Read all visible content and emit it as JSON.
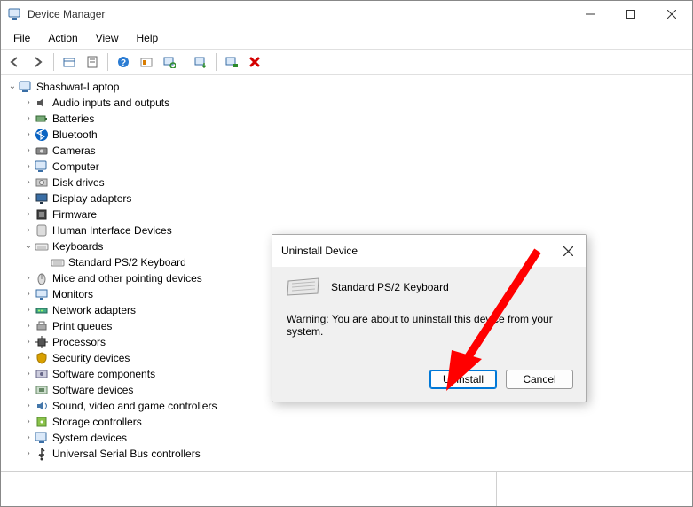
{
  "window": {
    "title": "Device Manager"
  },
  "menubar": {
    "items": [
      "File",
      "Action",
      "View",
      "Help"
    ]
  },
  "toolbar": {
    "icons": [
      "back-icon",
      "forward-icon",
      "sep",
      "show-hidden-icon",
      "properties-icon",
      "sep",
      "help-icon",
      "action-icon",
      "scan-hardware-icon",
      "sep",
      "update-driver-icon",
      "sep",
      "uninstall-driver-icon",
      "disable-device-icon"
    ]
  },
  "tree": {
    "root": {
      "label": "Shashwat-Laptop",
      "icon": "computer-icon",
      "expanded": true
    },
    "nodes": [
      {
        "label": "Audio inputs and outputs",
        "icon": "audio-icon",
        "expandable": true
      },
      {
        "label": "Batteries",
        "icon": "battery-icon",
        "expandable": true
      },
      {
        "label": "Bluetooth",
        "icon": "bluetooth-icon",
        "expandable": true
      },
      {
        "label": "Cameras",
        "icon": "camera-icon",
        "expandable": true
      },
      {
        "label": "Computer",
        "icon": "computer-icon",
        "expandable": true
      },
      {
        "label": "Disk drives",
        "icon": "disk-icon",
        "expandable": true
      },
      {
        "label": "Display adapters",
        "icon": "display-icon",
        "expandable": true
      },
      {
        "label": "Firmware",
        "icon": "firmware-icon",
        "expandable": true
      },
      {
        "label": "Human Interface Devices",
        "icon": "hid-icon",
        "expandable": true
      },
      {
        "label": "Keyboards",
        "icon": "keyboard-icon",
        "expandable": true,
        "expanded": true,
        "children": [
          {
            "label": "Standard PS/2 Keyboard",
            "icon": "keyboard-icon"
          }
        ]
      },
      {
        "label": "Mice and other pointing devices",
        "icon": "mouse-icon",
        "expandable": true
      },
      {
        "label": "Monitors",
        "icon": "monitor-icon",
        "expandable": true
      },
      {
        "label": "Network adapters",
        "icon": "network-icon",
        "expandable": true
      },
      {
        "label": "Print queues",
        "icon": "printer-icon",
        "expandable": true
      },
      {
        "label": "Processors",
        "icon": "cpu-icon",
        "expandable": true
      },
      {
        "label": "Security devices",
        "icon": "security-icon",
        "expandable": true
      },
      {
        "label": "Software components",
        "icon": "software-comp-icon",
        "expandable": true
      },
      {
        "label": "Software devices",
        "icon": "software-dev-icon",
        "expandable": true
      },
      {
        "label": "Sound, video and game controllers",
        "icon": "sound-icon",
        "expandable": true
      },
      {
        "label": "Storage controllers",
        "icon": "storage-icon",
        "expandable": true
      },
      {
        "label": "System devices",
        "icon": "system-icon",
        "expandable": true
      },
      {
        "label": "Universal Serial Bus controllers",
        "icon": "usb-icon",
        "expandable": true
      }
    ]
  },
  "dialog": {
    "title": "Uninstall Device",
    "device_name": "Standard PS/2 Keyboard",
    "warning": "Warning: You are about to uninstall this device from your system.",
    "buttons": {
      "primary": "Uninstall",
      "cancel": "Cancel"
    }
  },
  "annotation": {
    "type": "arrow",
    "color": "#ff0000",
    "target": "uninstall-button"
  }
}
